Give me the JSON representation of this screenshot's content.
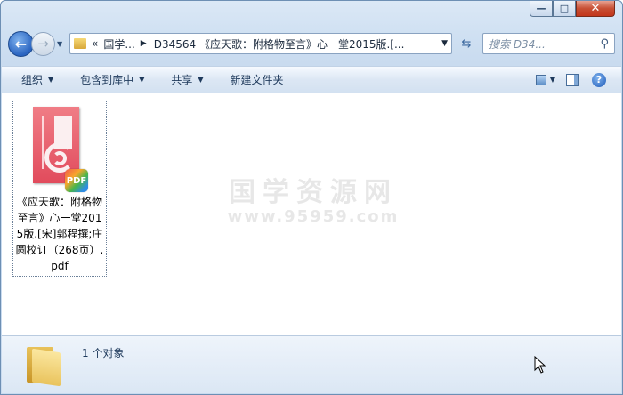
{
  "window": {
    "minimize_glyph": "—",
    "maximize_glyph": "□",
    "close_glyph": "✕"
  },
  "nav": {
    "back_glyph": "←",
    "forward_glyph": "→",
    "address": {
      "overflow": "«",
      "segments": [
        "国学...",
        "D34564 《应天歌：附格物至言》心一堂2015版.[..."
      ]
    },
    "search_placeholder": "搜索 D34..."
  },
  "toolbar": {
    "organize": "组织",
    "include_in_library": "包含到库中",
    "share": "共享",
    "new_folder": "新建文件夹"
  },
  "content": {
    "files": [
      {
        "name": "《应天歌：附格物至言》心一堂2015版.[宋]郭程撰;庄圆校订（268页）.pdf",
        "badge": "PDF"
      }
    ],
    "watermark": {
      "title": "国学资源网",
      "url": "www.95959.com"
    }
  },
  "status": {
    "count_text": "1 个对象"
  }
}
